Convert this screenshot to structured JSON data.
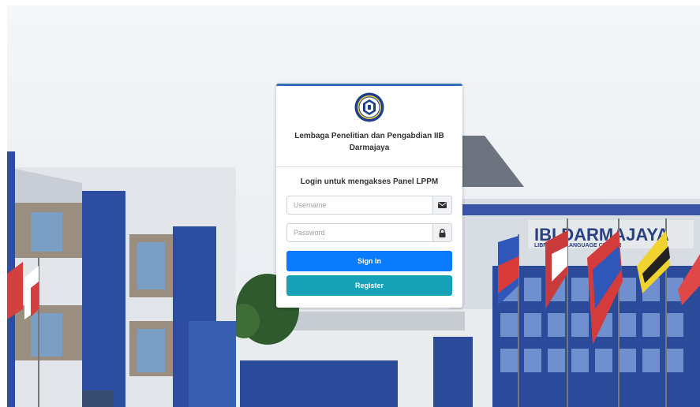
{
  "login_card": {
    "org_name": "Lembaga Penelitian dan Pengabdian IIB Darmajaya",
    "login_title": "Login untuk mengakses Panel LPPM",
    "username_placeholder": "Username",
    "password_placeholder": "Password",
    "signin_label": "Sign In",
    "register_label": "Register"
  },
  "background": {
    "building_sign": "IBI DARMAJAYA",
    "building_subsign": "LIBRARY & LANGUAGE CENTER"
  },
  "colors": {
    "accent_border": "#2e6fb5",
    "signin_button": "#0b7bfd",
    "register_button": "#17a2b8"
  },
  "icons": {
    "username_addon": "envelope-icon",
    "password_addon": "lock-icon"
  }
}
